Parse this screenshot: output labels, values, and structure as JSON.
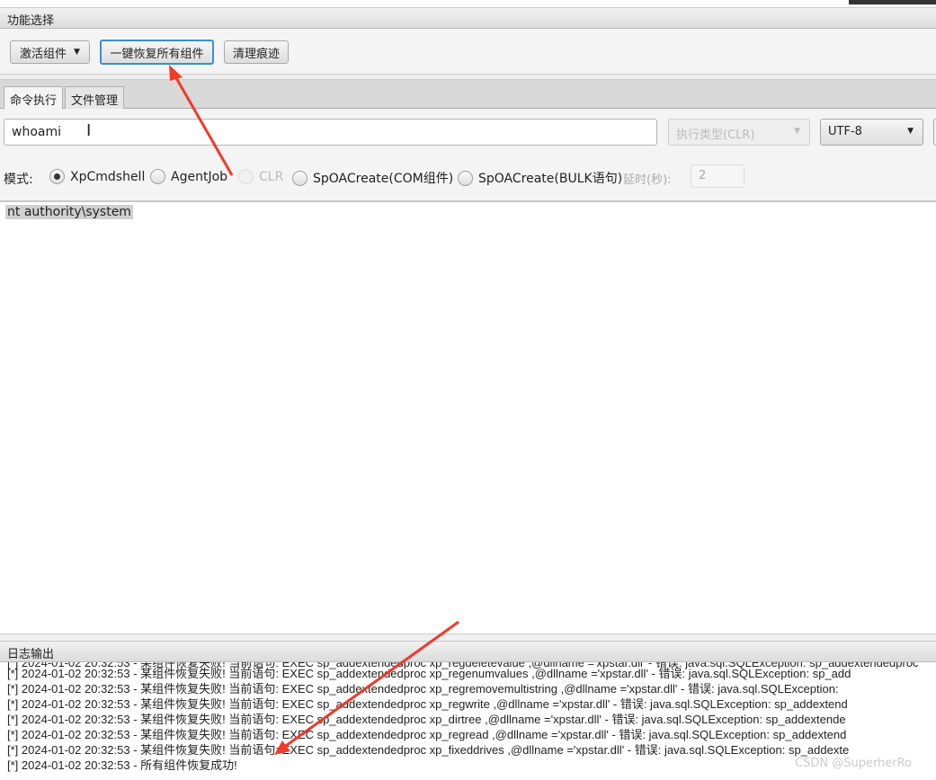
{
  "section_title": "功能选择",
  "toolbar": {
    "activate": "激活组件",
    "restore_all": "一键恢复所有组件",
    "clear_traces": "清理痕迹"
  },
  "tabs": [
    {
      "label": "命令执行",
      "active": true
    },
    {
      "label": "文件管理",
      "active": false
    }
  ],
  "command": {
    "value": "whoami",
    "exec_type": "执行类型(CLR)",
    "encoding": "UTF-8"
  },
  "mode": {
    "label": "模式:",
    "options": [
      {
        "label": "XpCmdshell",
        "checked": true,
        "disabled": false
      },
      {
        "label": "AgentJob",
        "checked": false,
        "disabled": false
      },
      {
        "label": "CLR",
        "checked": false,
        "disabled": true
      },
      {
        "label": "SpOACreate(COM组件)",
        "checked": false,
        "disabled": false
      },
      {
        "label": "SpOACreate(BULK语句)",
        "checked": false,
        "disabled": false
      }
    ],
    "delay_label": "延时(秒):",
    "delay_value": "2"
  },
  "output": "nt authority\\system",
  "log": {
    "title": "日志输出",
    "lines": [
      "[*] 2024-01-02 20:32:53 - 某组件恢复失败! 当前语句: EXEC sp_addextendedproc xp_regdeletevalue ,@dllname ='xpstar.dll' - 错误: java.sql.SQLException: sp_addextendedproc",
      "[*] 2024-01-02 20:32:53 - 某组件恢复失败! 当前语句: EXEC sp_addextendedproc xp_regenumvalues ,@dllname ='xpstar.dll' - 错误: java.sql.SQLException: sp_add",
      "[*] 2024-01-02 20:32:53 - 某组件恢复失败! 当前语句: EXEC sp_addextendedproc xp_regremovemultistring ,@dllname ='xpstar.dll' - 错误: java.sql.SQLException:",
      "[*] 2024-01-02 20:32:53 - 某组件恢复失败! 当前语句: EXEC sp_addextendedproc xp_regwrite ,@dllname ='xpstar.dll' - 错误: java.sql.SQLException: sp_addextend",
      "[*] 2024-01-02 20:32:53 - 某组件恢复失败! 当前语句: EXEC sp_addextendedproc xp_dirtree ,@dllname ='xpstar.dll' - 错误: java.sql.SQLException: sp_addextende",
      "[*] 2024-01-02 20:32:53 - 某组件恢复失败! 当前语句: EXEC sp_addextendedproc xp_regread ,@dllname ='xpstar.dll' - 错误: java.sql.SQLException: sp_addextend",
      "[*] 2024-01-02 20:32:53 - 某组件恢复失败! 当前语句: EXEC sp_addextendedproc xp_fixeddrives ,@dllname ='xpstar.dll' - 错误: java.sql.SQLException: sp_addexte",
      "[*] 2024-01-02 20:32:53 - 所有组件恢复成功!"
    ]
  },
  "watermark": "CSDN @SuperherRo",
  "colors": {
    "arrow": "#f03a2a",
    "focus": "#3c8fcc"
  }
}
